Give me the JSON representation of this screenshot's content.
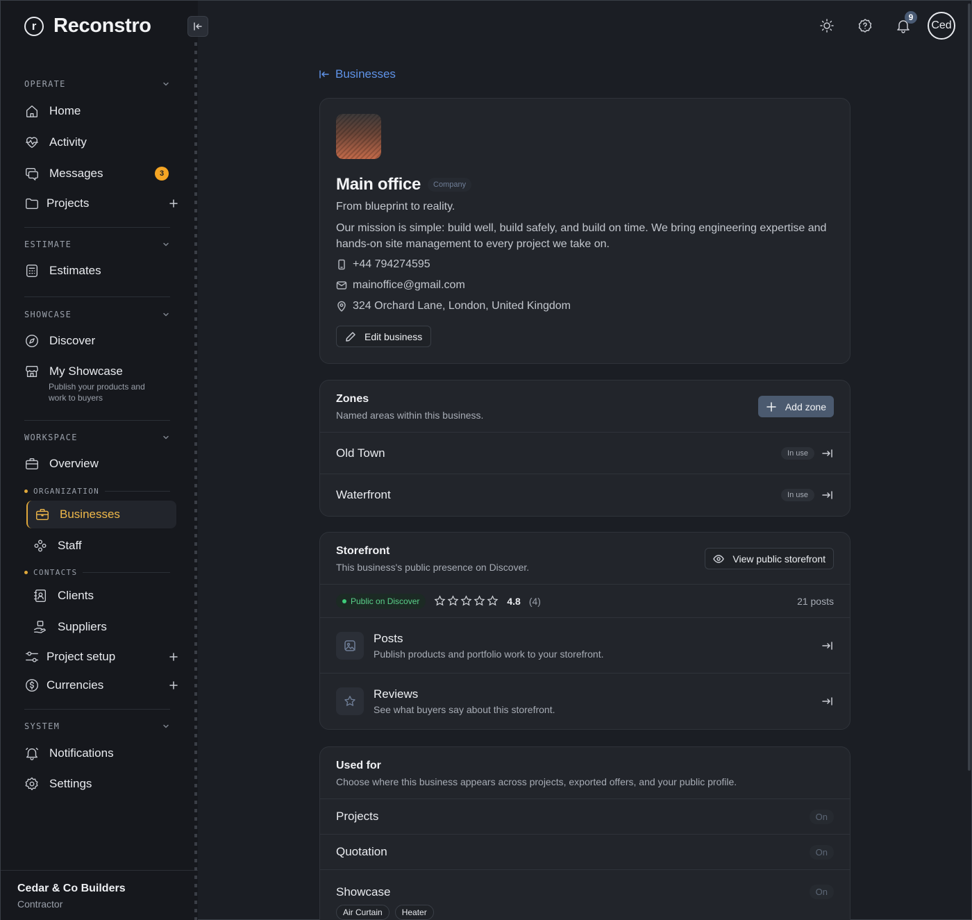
{
  "app": {
    "name": "Reconstro",
    "logo_letter": "r"
  },
  "sidebar": {
    "operate": {
      "label": "OPERATE",
      "items": [
        {
          "label": "Home",
          "icon": "home-icon"
        },
        {
          "label": "Activity",
          "icon": "activity-icon"
        },
        {
          "label": "Messages",
          "icon": "messages-icon",
          "badge": "3"
        },
        {
          "label": "Projects",
          "icon": "folder-icon"
        }
      ]
    },
    "estimate": {
      "label": "ESTIMATE",
      "items": [
        {
          "label": "Estimates",
          "icon": "calculator-icon"
        }
      ]
    },
    "showcase": {
      "label": "SHOWCASE",
      "items": [
        {
          "label": "Discover",
          "icon": "compass-icon"
        },
        {
          "label": "My Showcase",
          "icon": "store-icon",
          "desc": "Publish your products and work to buyers"
        }
      ]
    },
    "workspace": {
      "label": "WORKSPACE",
      "items": [
        {
          "label": "Overview",
          "icon": "briefcase-icon"
        }
      ],
      "organization": {
        "label": "ORGANIZATION",
        "items": [
          {
            "label": "Businesses",
            "icon": "briefcase-icon",
            "active": true
          },
          {
            "label": "Staff",
            "icon": "staff-icon"
          }
        ]
      },
      "contacts": {
        "label": "CONTACTS",
        "items": [
          {
            "label": "Clients",
            "icon": "contact-card-icon"
          },
          {
            "label": "Suppliers",
            "icon": "supplier-icon"
          }
        ]
      },
      "extra": [
        {
          "label": "Project setup",
          "icon": "sliders-icon"
        },
        {
          "label": "Currencies",
          "icon": "dollar-icon"
        }
      ]
    },
    "system": {
      "label": "SYSTEM",
      "items": [
        {
          "label": "Notifications",
          "icon": "bell-icon"
        },
        {
          "label": "Settings",
          "icon": "gear-icon"
        }
      ]
    },
    "org": {
      "name": "Cedar & Co Builders",
      "role": "Contractor"
    }
  },
  "topbar": {
    "notification_count": "9",
    "avatar_text": "Ced"
  },
  "breadcrumb": {
    "back_label": "Businesses"
  },
  "business": {
    "name": "Main office",
    "type": "Company",
    "tagline": "From blueprint to reality.",
    "mission": "Our mission is simple: build well, build safely, and build on time. We bring engineering expertise and hands-on site management to every project we take on.",
    "phone": "+44 794274595",
    "email": "mainoffice@gmail.com",
    "address": "324 Orchard Lane, London, United Kingdom",
    "edit_label": "Edit business"
  },
  "zones": {
    "title": "Zones",
    "subtitle": "Named areas within this business.",
    "add_label": "Add zone",
    "items": [
      {
        "name": "Old Town",
        "status": "In use"
      },
      {
        "name": "Waterfront",
        "status": "In use"
      }
    ]
  },
  "storefront": {
    "title": "Storefront",
    "subtitle": "This business's public presence on Discover.",
    "view_label": "View public storefront",
    "status": "Public on Discover",
    "rating": "4.8",
    "rating_count": "(4)",
    "stars": 5,
    "posts_count": "21 posts",
    "features": [
      {
        "title": "Posts",
        "sub": "Publish products and portfolio work to your storefront.",
        "icon": "image-icon"
      },
      {
        "title": "Reviews",
        "sub": "See what buyers say about this storefront.",
        "icon": "star-icon"
      }
    ]
  },
  "used_for": {
    "title": "Used for",
    "subtitle": "Choose where this business appears across projects, exported offers, and your public profile.",
    "items": [
      {
        "label": "Projects",
        "value": "On"
      },
      {
        "label": "Quotation",
        "value": "On"
      },
      {
        "label": "Showcase",
        "value": "On"
      }
    ],
    "chips": [
      "Air Curtain",
      "Heater"
    ]
  }
}
